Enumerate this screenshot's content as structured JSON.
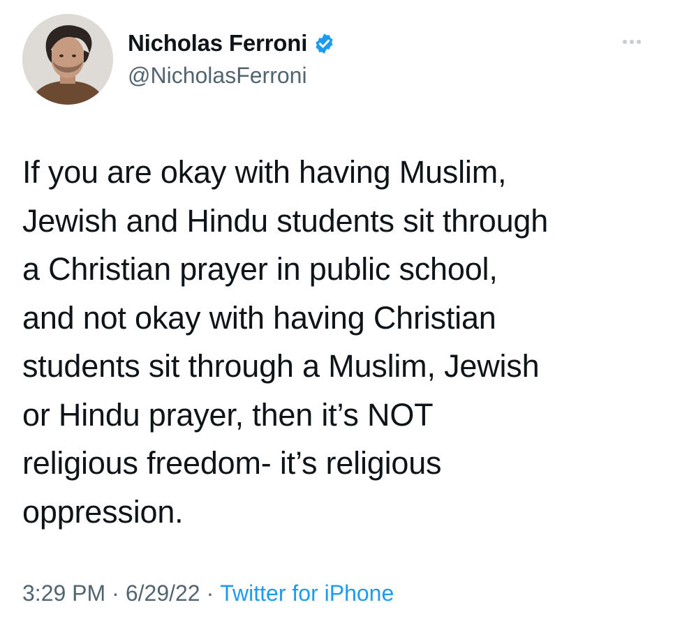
{
  "tweet": {
    "author": {
      "display_name": "Nicholas Ferroni",
      "handle": "@NicholasFerroni",
      "verified": true
    },
    "more_icon": "more-horizontal-icon",
    "text_lines": [
      "If you are okay with having Muslim,",
      "Jewish and Hindu students sit through",
      "a Christian prayer in public school,",
      "and not okay with having Christian",
      "students sit through a Muslim, Jewish",
      "or Hindu prayer, then it’s NOT",
      "religious freedom- it’s religious",
      "oppression."
    ],
    "time": "3:29 PM",
    "separator": "·",
    "date": "6/29/22",
    "source": "Twitter for iPhone"
  },
  "colors": {
    "text": "#0f1419",
    "secondary": "#536471",
    "accent": "#1d9bf0"
  }
}
